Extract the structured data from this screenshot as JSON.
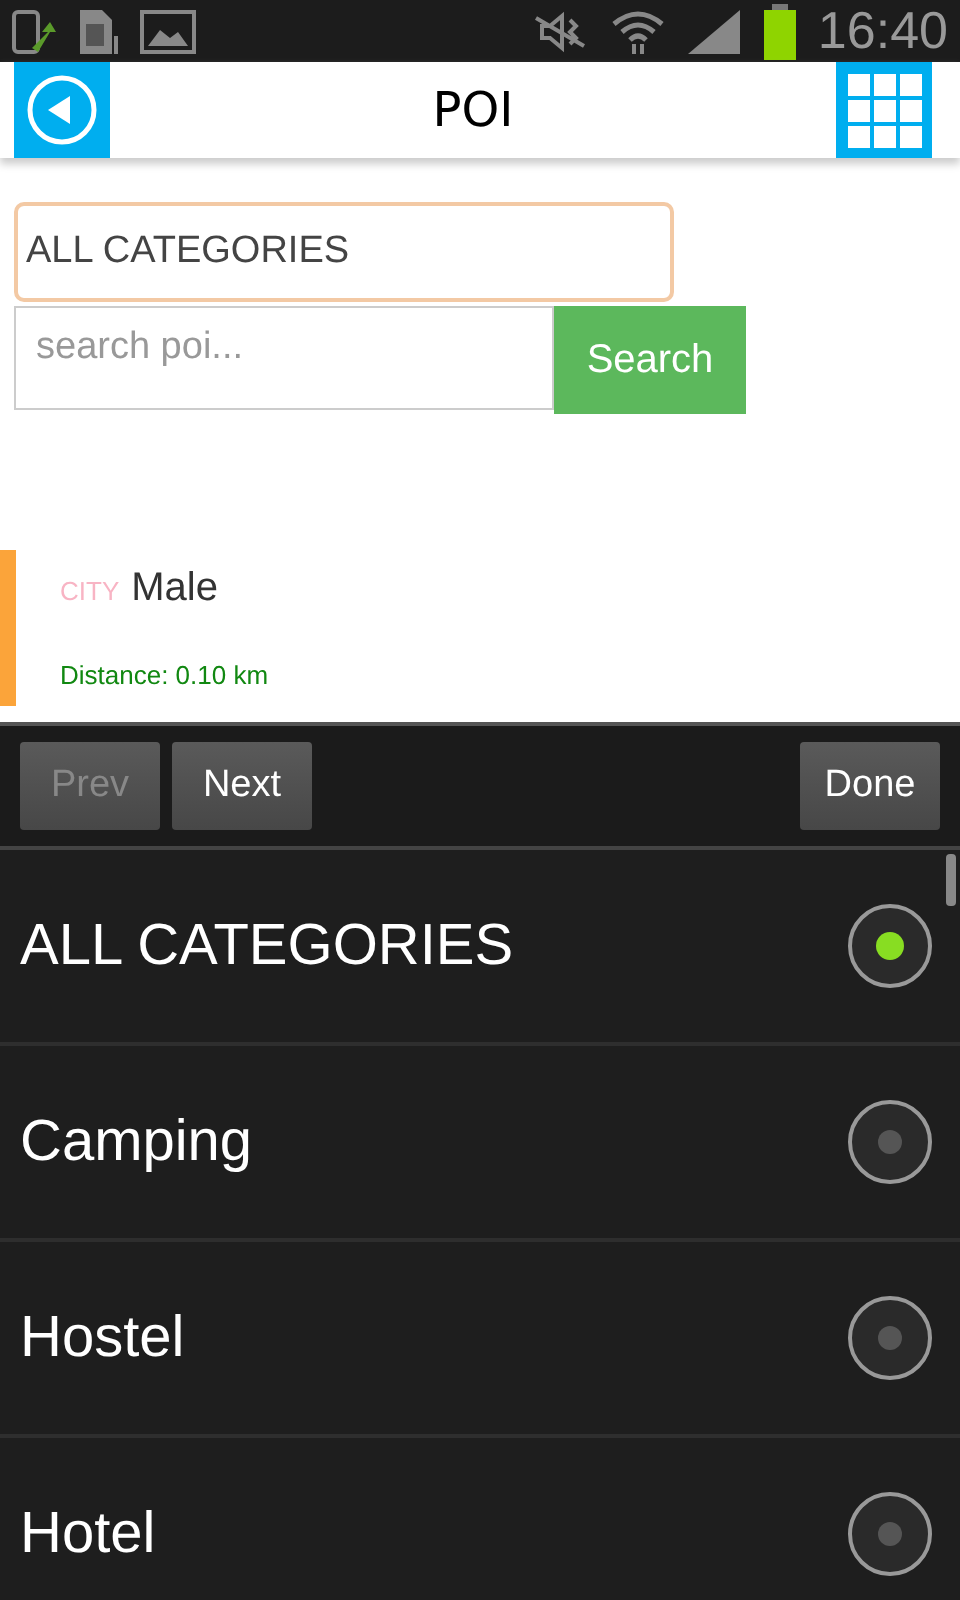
{
  "status_bar": {
    "time": "16:40"
  },
  "header": {
    "title": "POI"
  },
  "category_field": {
    "value": "ALL CATEGORIES"
  },
  "search": {
    "placeholder": "search poi...",
    "button": "Search"
  },
  "results": [
    {
      "category": "CITY",
      "name": "Male",
      "distance": "Distance: 0.10 km"
    }
  ],
  "picker_toolbar": {
    "buttons": [
      {
        "label": "Prev",
        "disabled": true
      },
      {
        "label": "Next",
        "disabled": false
      }
    ],
    "done": "Done"
  },
  "options": [
    {
      "label": "ALL CATEGORIES",
      "selected": true
    },
    {
      "label": "Camping",
      "selected": false
    },
    {
      "label": "Hostel",
      "selected": false
    },
    {
      "label": "Hotel",
      "selected": false
    }
  ]
}
